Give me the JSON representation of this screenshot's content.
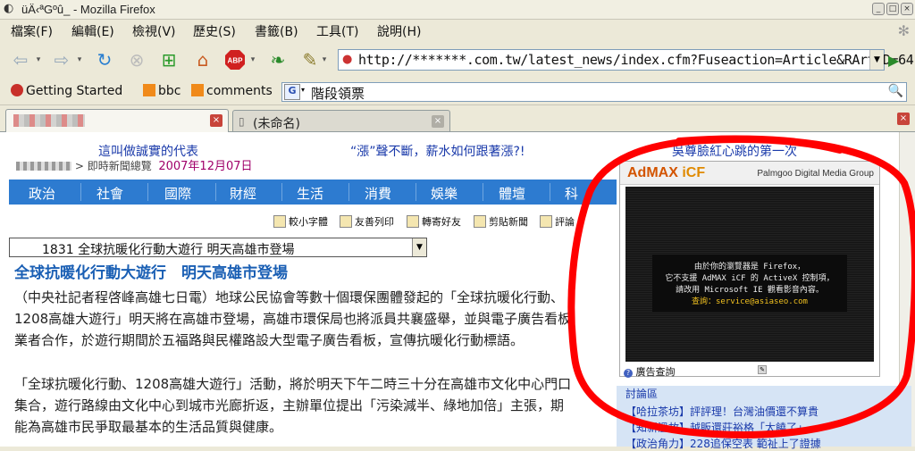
{
  "window": {
    "title": "üÄ‹ªGºû_ - Mozilla Firefox"
  },
  "menu": {
    "items": [
      "檔案(F)",
      "編輯(E)",
      "檢視(V)",
      "歷史(S)",
      "書籤(B)",
      "工具(T)",
      "說明(H)"
    ]
  },
  "navigation": {
    "url": "http://*******.com.tw/latest_news/index.cfm?Fuseaction=Article&RArtID=64"
  },
  "bookmarks": {
    "items": [
      "Getting Started",
      "bbc",
      "comments"
    ],
    "search_engine": "G",
    "search_query": "階段領票"
  },
  "tabs": [
    {
      "label": "",
      "active": true
    },
    {
      "label": "(未命名)",
      "active": false
    }
  ],
  "page": {
    "promos": [
      "這叫做誠實的代表",
      "“漲”聲不斷，薪水如何跟著漲?!",
      "吳尊臉紅心跳的第一次"
    ],
    "dateline_section": "即時新聞總覽",
    "dateline_date": "2007年12月07日",
    "categories": [
      "政治",
      "社會",
      "國際",
      "財經",
      "生活",
      "消費",
      "娛樂",
      "體壇",
      "科"
    ],
    "tools": [
      "較小字體",
      "友善列印",
      "轉寄好友",
      "剪貼新聞",
      "評論"
    ],
    "selected_article": "1831 全球抗暖化行動大遊行 明天高雄市登場",
    "headline": "全球抗暖化行動大遊行　明天高雄市登場",
    "paragraph1_lines": [
      "（中央社記者程啓峰高雄七日電）地球公民協會等數十個環保團體發起的「全球抗暖化行動、",
      "1208高雄大遊行」明天將在高雄市登場，高雄市環保局也將派員共襄盛舉，並與電子廣告看板",
      "業者合作，於遊行期間於五福路與民權路設大型電子廣告看板，宣傳抗暖化行動標語。"
    ],
    "paragraph2_lines": [
      "「全球抗暖化行動、1208高雄大遊行」活動，將於明天下午二時三十分在高雄市文化中心門口",
      "集合，遊行路線由文化中心到城市光廊折返，主辦單位提出「污染減半、綠地加倍」主張，期",
      "能為高雄市民爭取最基本的生活品質與健康。"
    ]
  },
  "ad": {
    "logo_main": "AdMAX",
    "logo_sub": " iCF",
    "group": "Palmgoo Digital Media Group",
    "msg_lines": [
      "由於你的瀏覽器是 Firefox，",
      "它不支援 AdMAX iCF 的 ActiveX 控制項，",
      "請改用 Microsoft IE 觀看影音內容。",
      "查詢：service@asiaseo.com"
    ],
    "footer": "廣告查詢"
  },
  "sidebar": {
    "header": "討論區",
    "links": [
      "【哈拉茶坊】評評理！台灣油價還不算貴",
      "【知新溫故】越販還莊裕格「太饒了」",
      "【政治角力】228追保空表 範祉上了證據"
    ]
  },
  "colors": {
    "accent_blue": "#2d7bd0",
    "headline_blue": "#1a5fb4",
    "annotation_red": "#ff0000"
  }
}
